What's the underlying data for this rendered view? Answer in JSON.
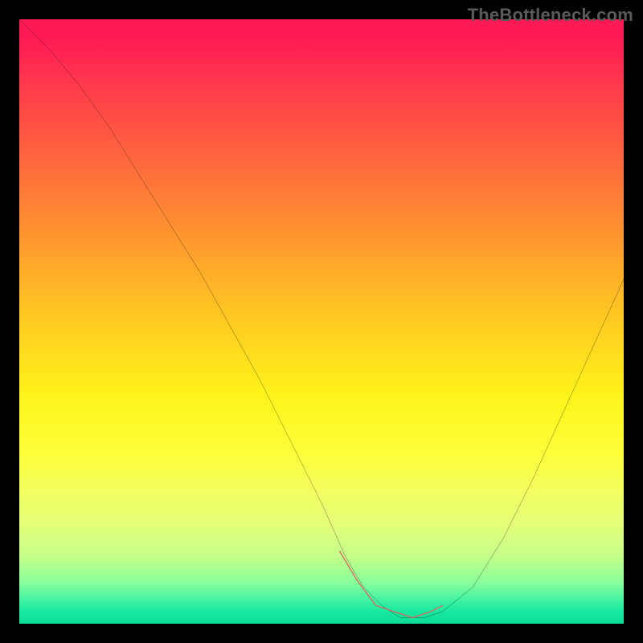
{
  "watermark": "TheBottleneck.com",
  "chart_data": {
    "type": "line",
    "title": "",
    "xlabel": "",
    "ylabel": "",
    "xlim": [
      0,
      100
    ],
    "ylim": [
      0,
      100
    ],
    "grid": false,
    "gradient_stops": [
      {
        "pct": 0,
        "color": "#ff1a55"
      },
      {
        "pct": 3,
        "color": "#ff1a55"
      },
      {
        "pct": 12,
        "color": "#ff3e4a"
      },
      {
        "pct": 24,
        "color": "#ff6a3d"
      },
      {
        "pct": 37,
        "color": "#ff9a2e"
      },
      {
        "pct": 49,
        "color": "#ffc722"
      },
      {
        "pct": 62,
        "color": "#fff31a"
      },
      {
        "pct": 72,
        "color": "#fdff3a"
      },
      {
        "pct": 78,
        "color": "#f4ff60"
      },
      {
        "pct": 84,
        "color": "#e2ff7a"
      },
      {
        "pct": 89,
        "color": "#c2ff8a"
      },
      {
        "pct": 93,
        "color": "#8cff9a"
      },
      {
        "pct": 96,
        "color": "#44f3a2"
      },
      {
        "pct": 98,
        "color": "#17e8a0"
      },
      {
        "pct": 100,
        "color": "#0cdc96"
      }
    ],
    "series": [
      {
        "name": "bottleneck-curve",
        "color": "#000000",
        "x": [
          0,
          5,
          10,
          15,
          20,
          25,
          30,
          35,
          40,
          45,
          50,
          54,
          57,
          60,
          63,
          67,
          70,
          75,
          80,
          85,
          90,
          95,
          100
        ],
        "y": [
          100,
          95,
          89,
          82,
          74,
          66,
          58,
          49,
          40,
          30,
          20,
          11,
          6,
          3,
          1,
          1,
          2,
          6,
          14,
          24,
          35,
          46,
          57
        ]
      },
      {
        "name": "highlight-segment",
        "color": "#e06361",
        "x": [
          53,
          56,
          59,
          62,
          65,
          68,
          70
        ],
        "y": [
          12,
          7,
          3,
          2,
          1,
          2,
          3
        ]
      }
    ],
    "annotations": []
  }
}
